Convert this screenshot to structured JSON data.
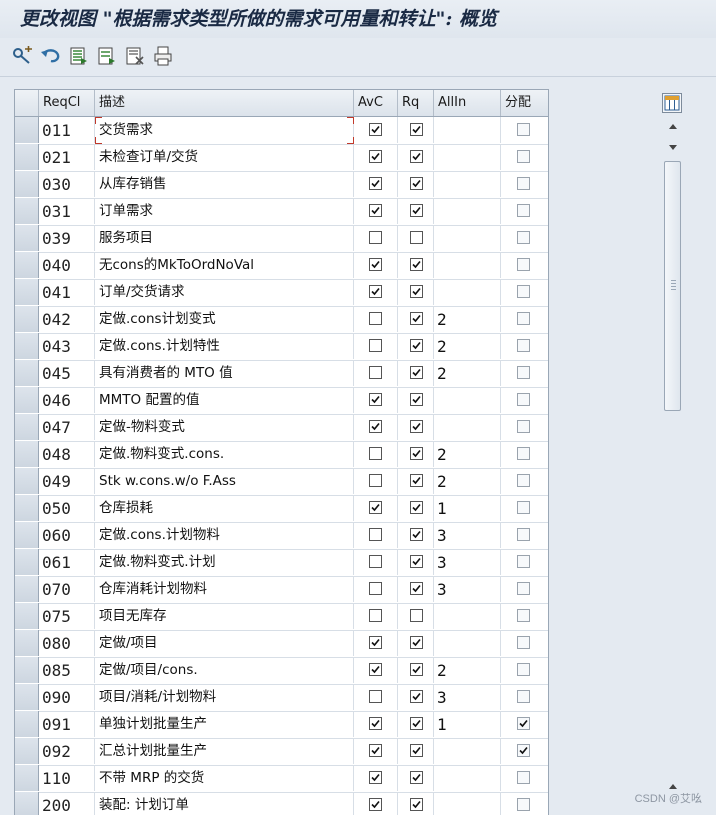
{
  "window": {
    "title": "更改视图 \"根据需求类型所做的需求可用量和转让\": 概览"
  },
  "toolbar": {
    "buttons": [
      {
        "name": "display-change-icon"
      },
      {
        "name": "undo-icon"
      },
      {
        "name": "select-all-icon"
      },
      {
        "name": "select-block-icon"
      },
      {
        "name": "deselect-all-icon"
      },
      {
        "name": "print-icon"
      }
    ]
  },
  "table": {
    "columns": {
      "reqcl": "ReqCl",
      "desc": "描述",
      "avc": "AvC",
      "rq": "Rq",
      "allin": "AllIn",
      "fp": "分配"
    },
    "rows": [
      {
        "code": "011",
        "desc": "交货需求",
        "avc": true,
        "rq": true,
        "allin": "",
        "fp": false
      },
      {
        "code": "021",
        "desc": "未检查订单/交货",
        "avc": true,
        "rq": true,
        "allin": "",
        "fp": false
      },
      {
        "code": "030",
        "desc": "从库存销售",
        "avc": true,
        "rq": true,
        "allin": "",
        "fp": false
      },
      {
        "code": "031",
        "desc": "订单需求",
        "avc": true,
        "rq": true,
        "allin": "",
        "fp": false
      },
      {
        "code": "039",
        "desc": "服务项目",
        "avc": false,
        "rq": false,
        "allin": "",
        "fp": false
      },
      {
        "code": "040",
        "desc": "无cons的MkToOrdNoVal",
        "avc": true,
        "rq": true,
        "allin": "",
        "fp": false
      },
      {
        "code": "041",
        "desc": "订单/交货请求",
        "avc": true,
        "rq": true,
        "allin": "",
        "fp": false
      },
      {
        "code": "042",
        "desc": "定做.cons计划变式",
        "avc": false,
        "rq": true,
        "allin": "2",
        "fp": false
      },
      {
        "code": "043",
        "desc": "定做.cons.计划特性",
        "avc": false,
        "rq": true,
        "allin": "2",
        "fp": false
      },
      {
        "code": "045",
        "desc": "具有消费者的 MTO 值",
        "avc": false,
        "rq": true,
        "allin": "2",
        "fp": false
      },
      {
        "code": "046",
        "desc": "MMTO 配置的值",
        "avc": true,
        "rq": true,
        "allin": "",
        "fp": false
      },
      {
        "code": "047",
        "desc": "定做-物料变式",
        "avc": true,
        "rq": true,
        "allin": "",
        "fp": false
      },
      {
        "code": "048",
        "desc": "定做.物料变式.cons.",
        "avc": false,
        "rq": true,
        "allin": "2",
        "fp": false
      },
      {
        "code": "049",
        "desc": "Stk w.cons.w/o F.Ass",
        "avc": false,
        "rq": true,
        "allin": "2",
        "fp": false
      },
      {
        "code": "050",
        "desc": "仓库损耗",
        "avc": true,
        "rq": true,
        "allin": "1",
        "fp": false
      },
      {
        "code": "060",
        "desc": "定做.cons.计划物料",
        "avc": false,
        "rq": true,
        "allin": "3",
        "fp": false
      },
      {
        "code": "061",
        "desc": "定做.物料变式.计划",
        "avc": false,
        "rq": true,
        "allin": "3",
        "fp": false
      },
      {
        "code": "070",
        "desc": "仓库消耗计划物料",
        "avc": false,
        "rq": true,
        "allin": "3",
        "fp": false
      },
      {
        "code": "075",
        "desc": "项目无库存",
        "avc": false,
        "rq": false,
        "allin": "",
        "fp": false
      },
      {
        "code": "080",
        "desc": "定做/项目",
        "avc": true,
        "rq": true,
        "allin": "",
        "fp": false
      },
      {
        "code": "085",
        "desc": "定做/项目/cons.",
        "avc": true,
        "rq": true,
        "allin": "2",
        "fp": false
      },
      {
        "code": "090",
        "desc": "项目/消耗/计划物料",
        "avc": false,
        "rq": true,
        "allin": "3",
        "fp": false
      },
      {
        "code": "091",
        "desc": "单独计划批量生产",
        "avc": true,
        "rq": true,
        "allin": "1",
        "fp": true
      },
      {
        "code": "092",
        "desc": "汇总计划批量生产",
        "avc": true,
        "rq": true,
        "allin": "",
        "fp": true
      },
      {
        "code": "110",
        "desc": "不带 MRP 的交货",
        "avc": true,
        "rq": true,
        "allin": "",
        "fp": false
      },
      {
        "code": "200",
        "desc": "装配: 计划订单",
        "avc": true,
        "rq": true,
        "allin": "",
        "fp": false
      }
    ]
  },
  "watermark": "CSDN @艾吆",
  "colors": {
    "background": "#e4eaf1",
    "header": "#dce3eb",
    "focus": "#c0392b"
  }
}
